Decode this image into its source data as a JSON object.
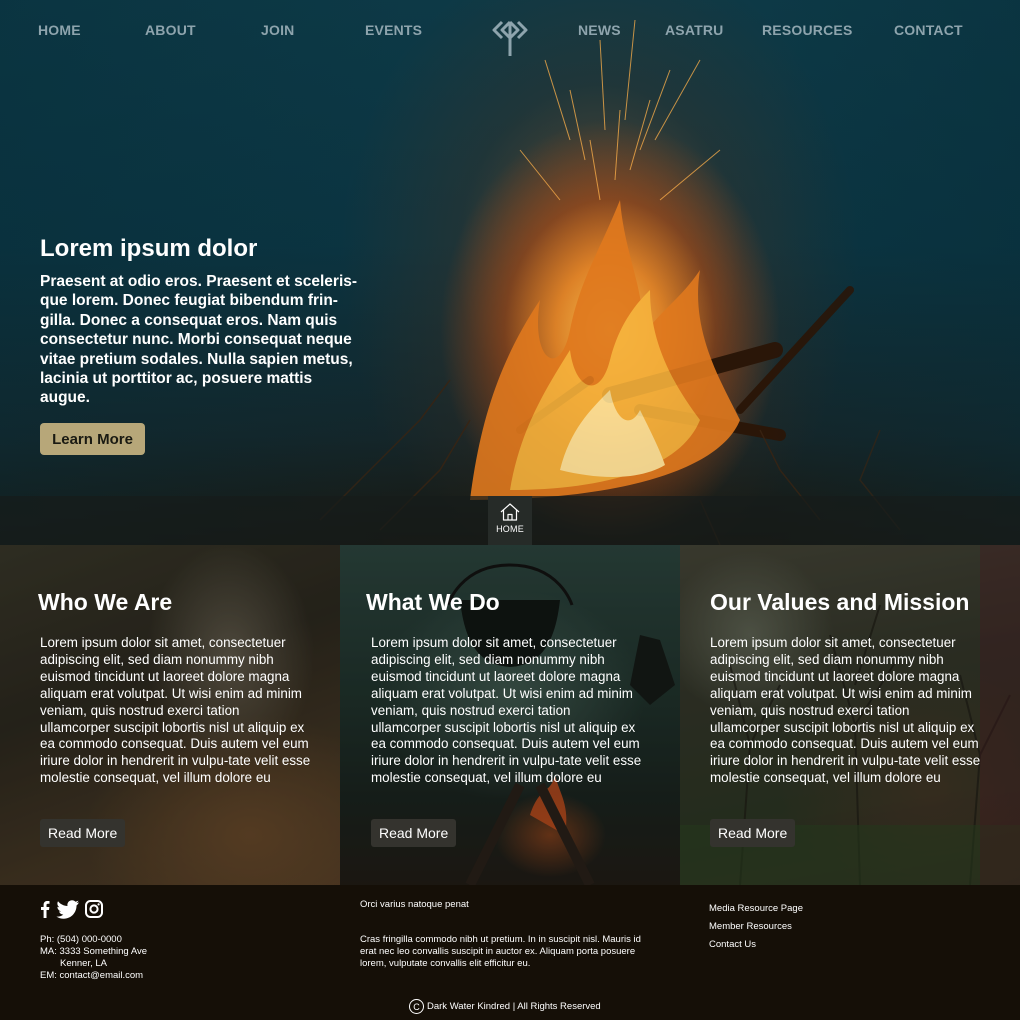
{
  "nav": {
    "items": [
      {
        "label": "HOME"
      },
      {
        "label": "ABOUT"
      },
      {
        "label": "JOIN"
      },
      {
        "label": "EVENTS"
      },
      {
        "label": "NEWS"
      },
      {
        "label": "ASATRU"
      },
      {
        "label": "RESOURCES"
      },
      {
        "label": "CONTACT"
      }
    ],
    "logo_icon": "rune-logo-icon"
  },
  "hero": {
    "title": "Lorem ipsum dolor",
    "body": "Praesent at odio eros. Praesent et sceleris-que lorem. Donec feugiat bibendum frin-gilla. Donec a consequat eros. Nam quis consectetur nunc. Morbi consequat neque vitae pretium sodales. Nulla sapien metus, lacinia ut porttitor ac, posuere mattis augue.",
    "button_label": "Learn More",
    "button_color": "#b7a779"
  },
  "home_tab": {
    "icon": "home-icon",
    "label": "HOME"
  },
  "panels": [
    {
      "title": "Who We Are",
      "body": "Lorem ipsum dolor sit amet, consectetuer adipiscing elit, sed diam nonummy nibh euismod tincidunt ut laoreet dolore magna aliquam erat volutpat. Ut wisi enim ad minim veniam, quis nostrud exerci tation ullamcorper suscipit lobortis nisl ut aliquip ex ea commodo consequat. Duis autem vel eum iriure dolor in hendrerit in vulpu-tate velit esse molestie consequat, vel illum dolore eu",
      "button_label": "Read More"
    },
    {
      "title": "What We Do",
      "body": "Lorem ipsum dolor sit amet, consectetuer adipiscing elit, sed diam nonummy nibh euismod tincidunt ut laoreet dolore magna aliquam erat volutpat. Ut wisi enim ad minim veniam, quis nostrud exerci tation ullamcorper suscipit lobortis nisl ut aliquip ex ea commodo consequat. Duis autem vel eum iriure dolor in hendrerit in vulpu-tate velit esse molestie consequat, vel illum dolore eu",
      "button_label": "Read More"
    },
    {
      "title": "Our Values and Mission",
      "body": "Lorem ipsum dolor sit amet, consectetuer adipiscing elit, sed diam nonummy nibh euismod tincidunt ut laoreet dolore magna aliquam erat volutpat. Ut wisi enim ad minim veniam, quis nostrud exerci tation ullamcorper suscipit lobortis nisl ut aliquip ex ea commodo consequat. Duis autem vel eum iriure dolor in hendrerit in vulpu-tate velit esse molestie consequat, vel illum dolore eu",
      "button_label": "Read More"
    }
  ],
  "footer": {
    "social_icons": [
      "facebook-icon",
      "twitter-icon",
      "instagram-icon"
    ],
    "contact": {
      "phone": "Ph: (504) 000-0000",
      "address_line1": "MA: 3333 Something Ave",
      "address_line2": "Kenner, LA",
      "email": "EM: contact@email.com"
    },
    "middle_title": "Orci varius natoque penat",
    "middle_body": "Cras fringilla commodo nibh ut pretium. In in suscipit nisl. Mauris id erat nec leo convallis suscipit in auctor ex. Aliquam porta posuere lorem, vulputate convallis elit efficitur eu.",
    "links": [
      {
        "label": "Media Resource Page"
      },
      {
        "label": "Member Resources"
      },
      {
        "label": "Contact Us"
      }
    ],
    "copyright_symbol": "C",
    "copyright_text": "Dark Water Kindred | All Rights Reserved"
  }
}
